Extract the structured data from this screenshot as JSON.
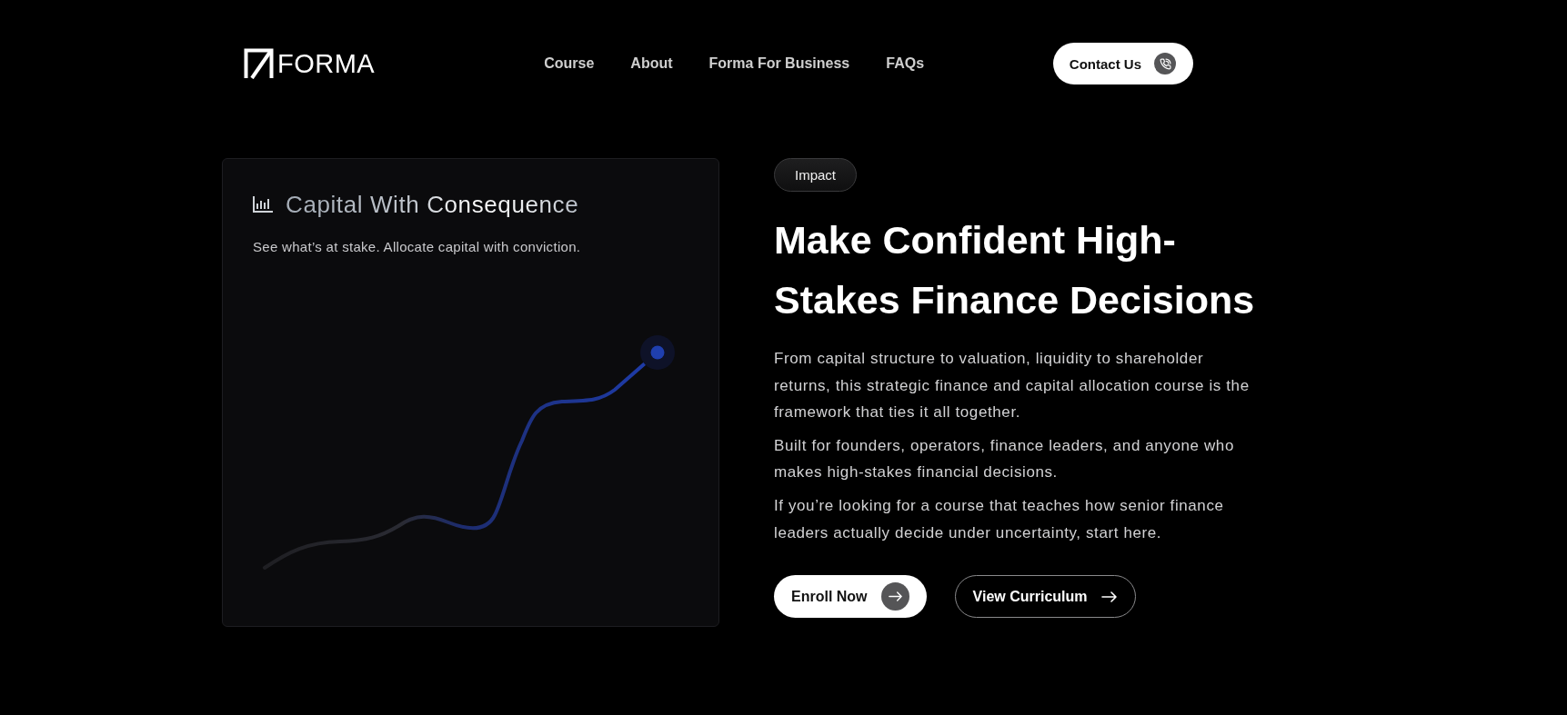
{
  "nav": {
    "logo": "FORMA",
    "links": [
      {
        "label": "Course"
      },
      {
        "label": "About"
      },
      {
        "label": "Forma For Business"
      },
      {
        "label": "FAQs"
      }
    ],
    "cta": "Contact Us"
  },
  "card": {
    "title": "Capital With Consequence",
    "subtitle": "See what’s at stake. Allocate capital with conviction."
  },
  "hero": {
    "tag": "Impact",
    "heading": "Make Confident High-Stakes Finance Decisions",
    "paragraphs": [
      "From capital structure to valuation, liquidity to shareholder returns, this strategic finance and capital allocation course is the framework that ties it all together.",
      "Built for founders, operators, finance leaders, and anyone who makes high-stakes financial decisions.",
      "If you’re looking for a course that teaches how senior finance leaders actually decide under uncertainty, start here."
    ],
    "buttons": [
      {
        "label": "Enroll Now",
        "kind": "primary"
      },
      {
        "label": "View Curriculum",
        "kind": "secondary"
      }
    ]
  }
}
